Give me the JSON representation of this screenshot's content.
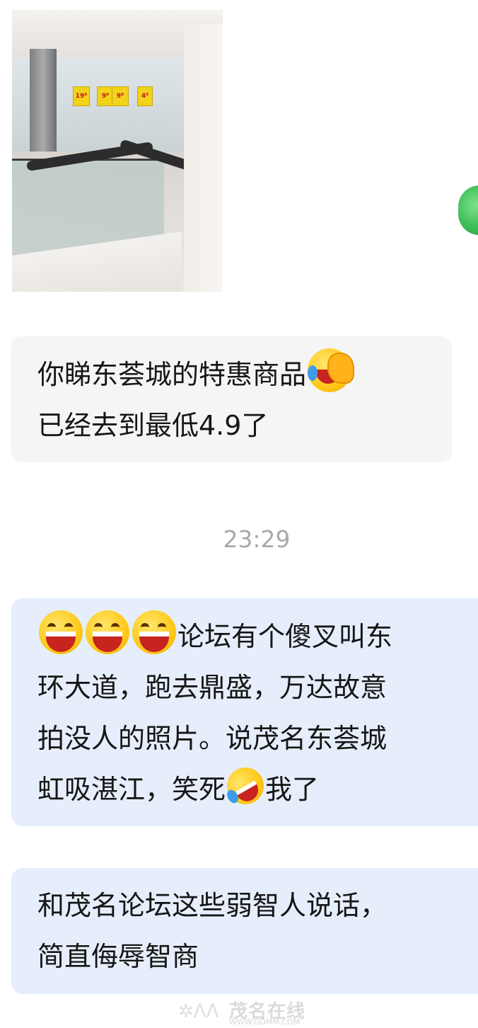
{
  "photo_message": {
    "sign_prices": [
      "19⁹",
      "9⁹",
      "9⁹",
      "4⁹"
    ]
  },
  "messages": [
    {
      "lines": [
        "你睇东荟城的特惠商品",
        "已经去到最低4.9了"
      ],
      "emoji": "facepalm-laugh-emoji"
    },
    {
      "lines": [
        "论坛有个傻叉叫东",
        "环大道，跑去鼎盛，万达故意",
        "拍没人的照片。说茂名东荟城",
        "虹吸湛江，笑死",
        "我了"
      ],
      "emoji": "grinning-emoji"
    },
    {
      "lines": [
        "和茂名论坛这些弱智人说话，",
        "简直侮辱智商"
      ]
    }
  ],
  "timestamp": "23:29",
  "watermark": {
    "name": "茂名在线",
    "url": "WWW.GDMM.COM"
  }
}
